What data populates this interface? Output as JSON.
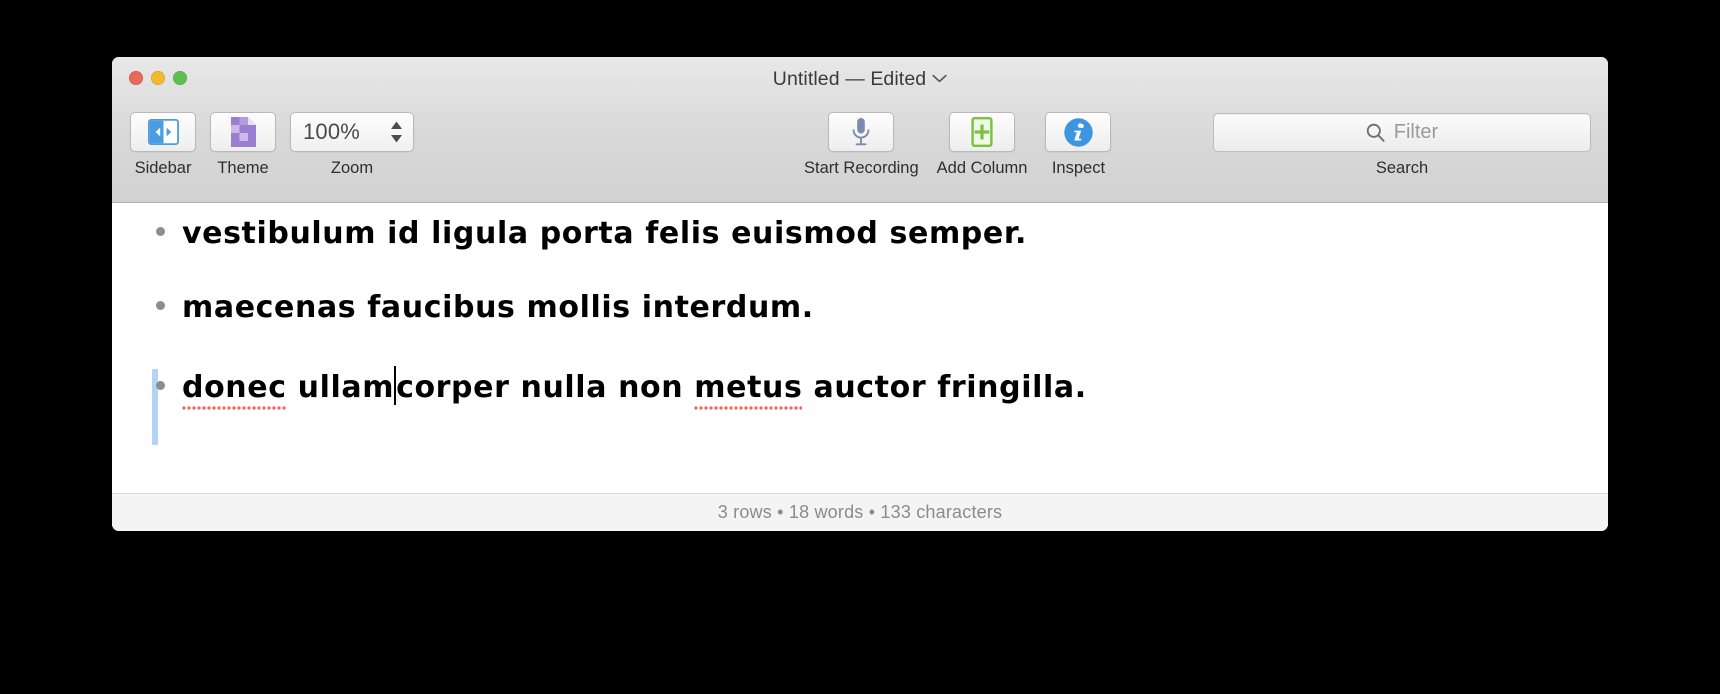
{
  "window": {
    "title_name": "Untitled",
    "title_separator": "—",
    "title_state": "Edited",
    "title_full": "Untitled — Edited",
    "traffic_lights": {
      "close_label": "close",
      "minimize_label": "minimize",
      "maximize_label": "maximize",
      "close_color": "#e9685c",
      "minimize_color": "#f0b92f",
      "maximize_color": "#5fc052"
    }
  },
  "toolbar": {
    "items": [
      {
        "id": "sidebar",
        "label": "Sidebar",
        "icon": "sidebar-toggle-icon"
      },
      {
        "id": "theme",
        "label": "Theme",
        "icon": "theme-document-icon"
      },
      {
        "id": "zoom",
        "label": "Zoom",
        "icon": "stepper-icon",
        "value": "100%"
      },
      {
        "id": "start-recording",
        "label": "Start Recording",
        "icon": "microphone-icon"
      },
      {
        "id": "add-column",
        "label": "Add Column",
        "icon": "add-column-icon"
      },
      {
        "id": "inspect",
        "label": "Inspect",
        "icon": "info-circle-icon"
      },
      {
        "id": "search",
        "label": "Search",
        "icon": "search-icon"
      }
    ],
    "sidebar_label": "Sidebar",
    "theme_label": "Theme",
    "zoom_label": "Zoom",
    "zoom_value": "100%",
    "recording_label": "Start Recording",
    "add_column_label": "Add Column",
    "inspect_label": "Inspect",
    "search_label": "Search"
  },
  "search": {
    "placeholder": "Filter",
    "value": ""
  },
  "document": {
    "rows": [
      {
        "active": false,
        "segments": [
          {
            "text": "vestibulum id ligula porta felis euismod semper.",
            "misspelled": false
          }
        ]
      },
      {
        "active": false,
        "segments": [
          {
            "text": "maecenas faucibus mollis interdum.",
            "misspelled": false
          }
        ]
      },
      {
        "active": true,
        "segments": [
          {
            "text": "donec",
            "misspelled": true
          },
          {
            "text": " ullam",
            "misspelled": false
          },
          {
            "text": "CARET",
            "misspelled": false
          },
          {
            "text": "corper nulla non ",
            "misspelled": false
          },
          {
            "text": "metus",
            "misspelled": true
          },
          {
            "text": " auctor fringilla.",
            "misspelled": false
          }
        ]
      }
    ],
    "row1_text": "vestibulum id ligula porta felis euismod semper.",
    "row2_text": "maecenas faucibus mollis interdum.",
    "row3_part1": "donec",
    "row3_part2": " ullam",
    "row3_part3": "corper nulla non ",
    "row3_part4": "metus",
    "row3_part5": " auctor fringilla.",
    "spellcheck_color": "#f2695c",
    "active_line_color": "#b3d4f5"
  },
  "status_bar": {
    "rows_count": 3,
    "words_count": 18,
    "characters_count": 133,
    "text": "3 rows • 18 words • 133 characters"
  },
  "colors": {
    "desktop_background": "#000000",
    "toolbar_background": "#d8d8d8",
    "document_background": "#ffffff",
    "status_background": "#f4f4f4",
    "sidebar_icon_accent": "#4a9de0",
    "theme_icon_accent": "#9b7ed0",
    "add_column_accent": "#7ac143",
    "info_accent": "#3d95e0",
    "mic_accent": "#7b8bb0"
  }
}
